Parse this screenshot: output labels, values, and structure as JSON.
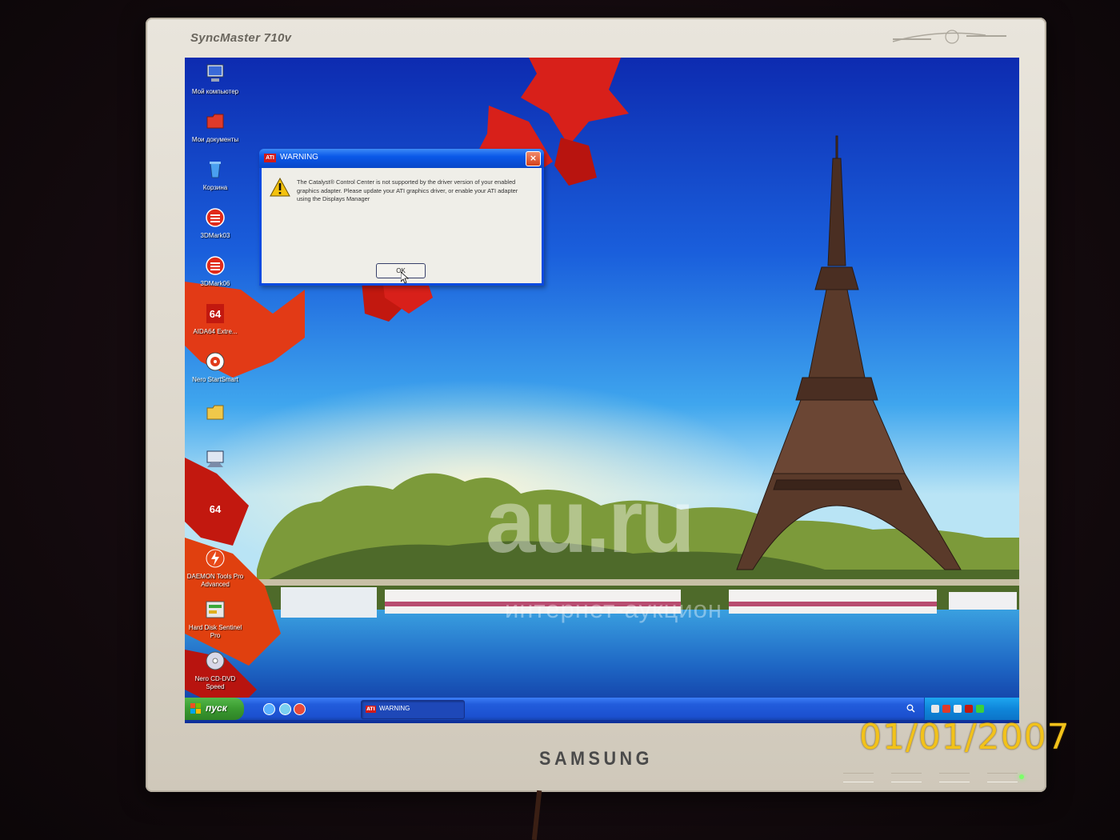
{
  "monitor": {
    "model": "SyncMaster 710v",
    "brand": "SAMSUNG"
  },
  "desktop": {
    "icons": [
      {
        "label": "Мой компьютер",
        "icon": "computer-icon"
      },
      {
        "label": "Мои документы",
        "icon": "documents-folder-icon"
      },
      {
        "label": "Корзина",
        "icon": "recycle-bin-icon"
      },
      {
        "label": "3DMark03",
        "icon": "3dmark-icon"
      },
      {
        "label": "3DMark06",
        "icon": "3dmark-icon"
      },
      {
        "label": "AIDA64 Extre...",
        "icon": "aida64-icon"
      },
      {
        "label": "Nero StartSmart",
        "icon": "nero-icon"
      },
      {
        "label": "",
        "icon": "folder-icon"
      },
      {
        "label": "",
        "icon": "network-icon"
      },
      {
        "label": "",
        "icon": "aida64-icon"
      },
      {
        "label": "DAEMON Tools Pro Advanced",
        "icon": "daemon-tools-icon"
      },
      {
        "label": "Hard Disk Sentinel Pro",
        "icon": "hard-disk-icon"
      },
      {
        "label": "Nero CD-DVD Speed",
        "icon": "cd-dvd-icon"
      }
    ]
  },
  "dialog": {
    "title": "WARNING",
    "logo_text": "ATI",
    "message": "The Catalyst® Control Center is not supported by the driver version of your enabled graphics adapter. Please update your ATI graphics driver, or enable your ATI adapter using the Displays Manager",
    "ok_label": "OK",
    "close_label": "×"
  },
  "taskbar": {
    "start_label": "пуск",
    "task_label": "WARNING",
    "task_logo": "ATI",
    "clock": ""
  },
  "watermark": {
    "main": "au.ru",
    "sub": "интернет-аукцион"
  },
  "photo": {
    "date_stamp": "01/01/2007"
  },
  "colors": {
    "taskbar_blue": "#225cdc",
    "start_green": "#3a9a30",
    "dialog_titlebar": "#0a58e8",
    "date_stamp": "#f2c21a",
    "ati_red": "#d11a1a"
  }
}
